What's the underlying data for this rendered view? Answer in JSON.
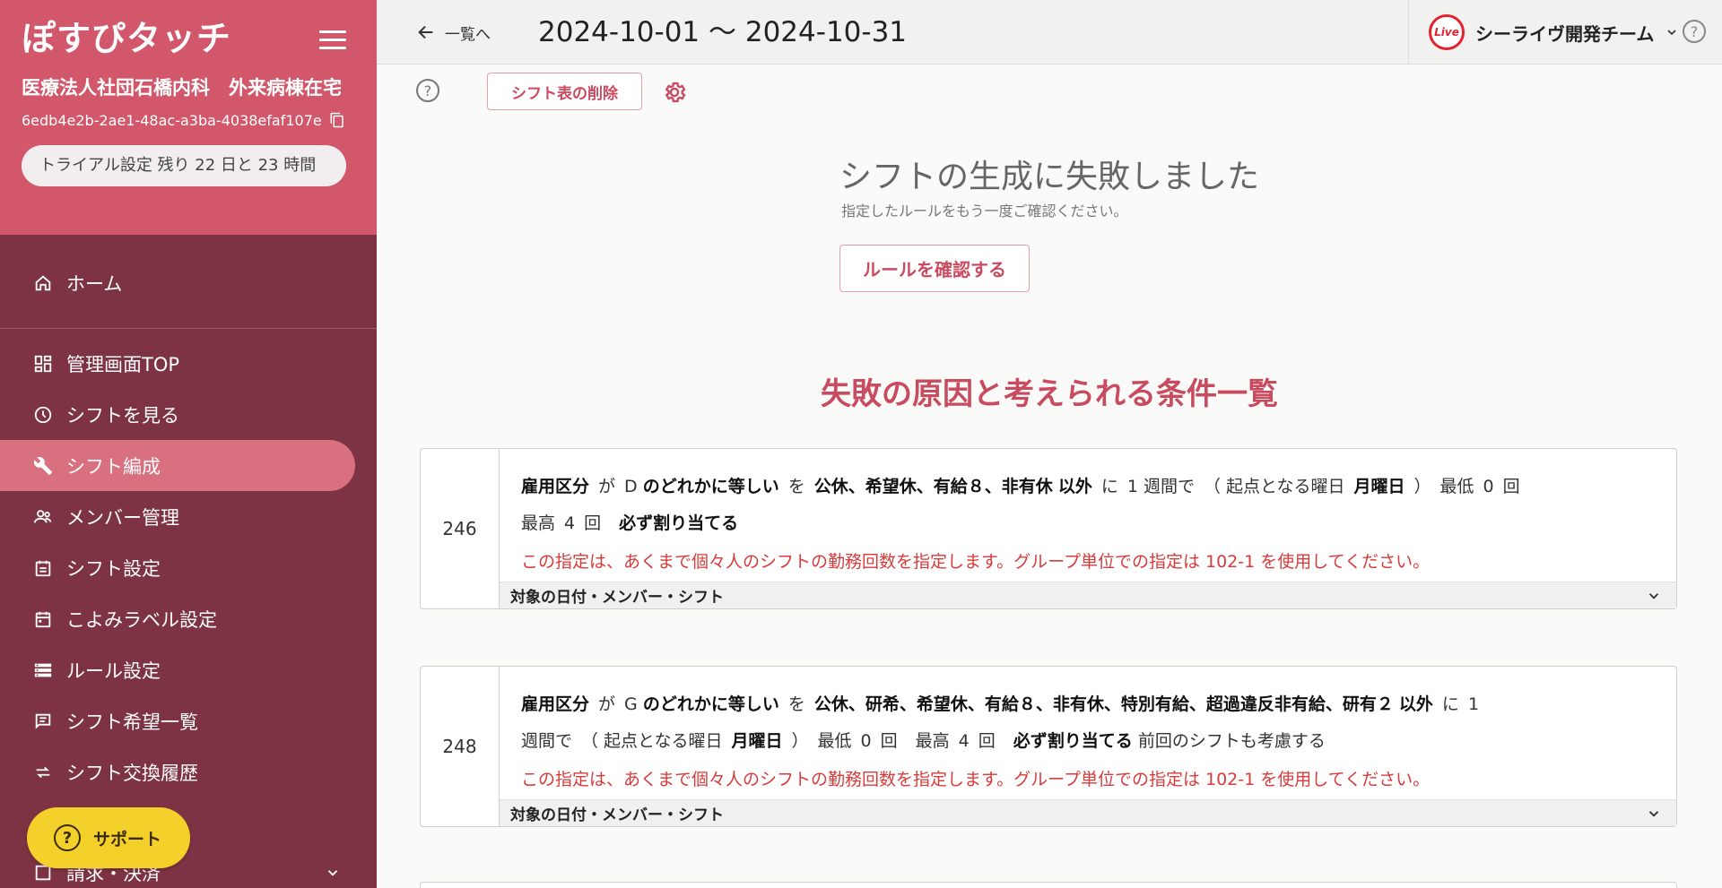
{
  "sidebar": {
    "logo_text": "ぽすぴタッチ",
    "org_name": "医療法人社団石橋内科　外来病棟在宅",
    "org_id": "6edb4e2b-2ae1-48ac-a3ba-4038efaf107e",
    "trial_text": "トライアル設定 残り 22 日と 23 時間",
    "home": "ホーム",
    "items": [
      {
        "label": "管理画面TOP",
        "icon": "dashboard-icon"
      },
      {
        "label": "シフトを見る",
        "icon": "clock-icon"
      },
      {
        "label": "シフト編成",
        "icon": "wrench-icon",
        "active": true
      },
      {
        "label": "メンバー管理",
        "icon": "people-icon"
      },
      {
        "label": "シフト設定",
        "icon": "calendar-list-icon"
      },
      {
        "label": "こよみラベル設定",
        "icon": "calendar-icon"
      },
      {
        "label": "ルール設定",
        "icon": "storage-icon"
      },
      {
        "label": "シフト希望一覧",
        "icon": "message-icon"
      },
      {
        "label": "シフト交換履歴",
        "icon": "swap-icon"
      }
    ],
    "billing": "請求・決済",
    "support_label": "サポート"
  },
  "header": {
    "back_label": "一覧へ",
    "period": "2024-10-01 〜 2024-10-31",
    "team_name": "シーライヴ開発チーム",
    "live_logo_text": "Live"
  },
  "toolbar": {
    "delete_label": "シフト表の削除"
  },
  "failure": {
    "title": "シフトの生成に失敗しました",
    "subtitle": "指定したルールをもう一度ご確認ください。",
    "check_button": "ルールを確認する",
    "conditions_heading": "失敗の原因と考えられる条件一覧"
  },
  "rules": [
    {
      "id": "246",
      "subject": "雇用区分",
      "ga": "が",
      "value": "D",
      "op": "のどれかに等しい",
      "wo": "を",
      "shifts": "公休、希望休、有給８、非有休",
      "except": "以外",
      "ni": "に",
      "period_n": "1",
      "period_unit": "週間で",
      "base_open": "（ 起点となる曜日",
      "base_day": "月曜日",
      "base_close": "）",
      "min_label": "最低",
      "min_n": "0",
      "max_label": "最高",
      "max_n": "4",
      "times": "回",
      "must": "必ず割り当てる",
      "extra": "",
      "note": "この指定は、あくまで個々人のシフトの勤務回数を指定します。グループ単位での指定は 102-1 を使用してください。",
      "expander": "対象の日付・メンバー・シフト"
    },
    {
      "id": "248",
      "subject": "雇用区分",
      "ga": "が",
      "value": "G",
      "op": "のどれかに等しい",
      "wo": "を",
      "shifts": "公休、研希、希望休、有給８、非有休、特別有給、超過違反非有給、研有２",
      "except": "以外",
      "ni": "に",
      "period_n": "1",
      "period_unit": "週間で",
      "base_open": "（ 起点となる曜日",
      "base_day": "月曜日",
      "base_close": "）",
      "min_label": "最低",
      "min_n": "0",
      "max_label": "最高",
      "max_n": "4",
      "times": "回",
      "must": "必ず割り当てる",
      "extra": "前回のシフトも考慮する",
      "note": "この指定は、あくまで個々人のシフトの勤務回数を指定します。グループ単位での指定は 102-1 を使用してください。",
      "expander": "対象の日付・メンバー・シフト"
    }
  ],
  "colors": {
    "sidebar_bg": "#7e3344",
    "sidebar_head": "#d2576a",
    "active_item": "#d8707f",
    "accent": "#c94b60",
    "warning_text": "#d93a3a",
    "support": "#f3d12a"
  }
}
